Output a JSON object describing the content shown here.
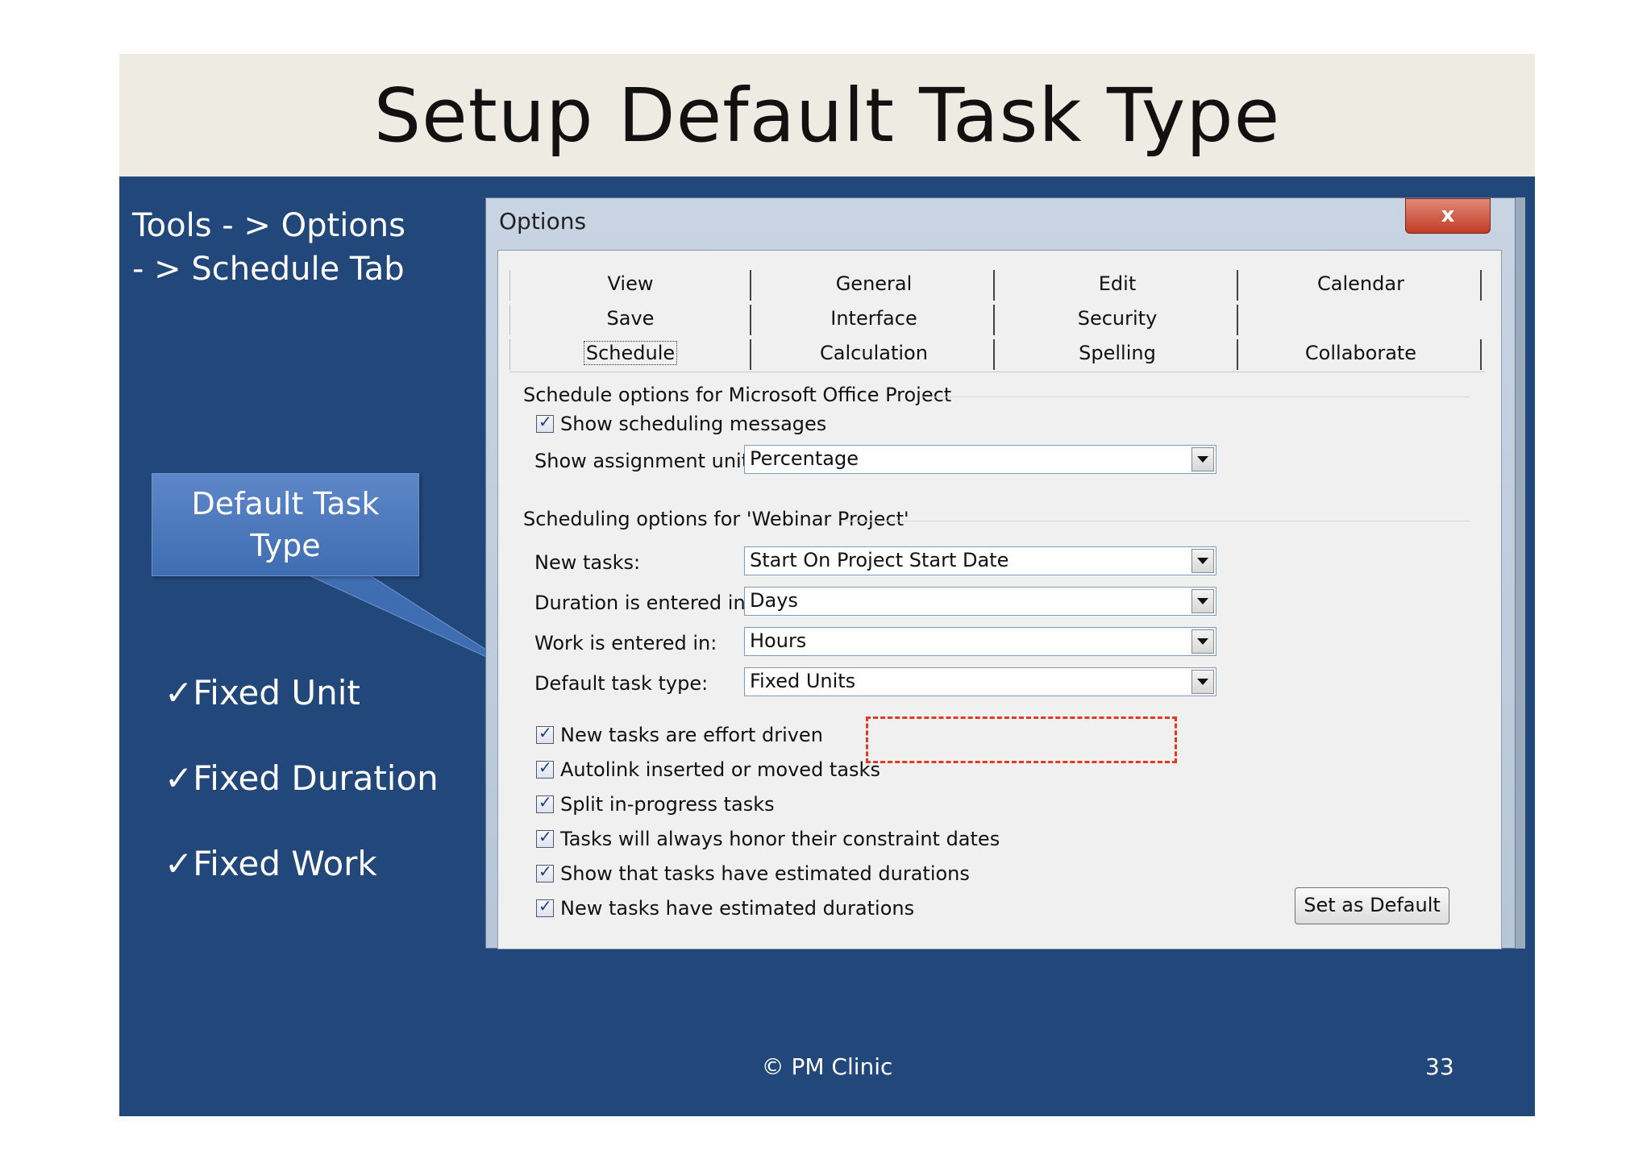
{
  "slide": {
    "title": "Setup Default Task Type",
    "nav_line1": "Tools - > Options",
    "nav_line2": "- > Schedule Tab",
    "callout_line1": "Default Task",
    "callout_line2": "Type",
    "checklist": [
      "✓Fixed Unit",
      "✓Fixed Duration",
      "✓Fixed Work"
    ],
    "footer_copyright": "© PM Clinic",
    "page_number": "33"
  },
  "dialog": {
    "title": "Options",
    "close_label": "x",
    "tabs": {
      "row1": [
        "View",
        "General",
        "Edit",
        "Calendar"
      ],
      "row2": [
        "Save",
        "Interface",
        "Security"
      ],
      "row3": [
        "Schedule",
        "Calculation",
        "Spelling",
        "Collaborate"
      ]
    },
    "schedule_group_label": "Schedule options for Microsoft Office Project",
    "show_scheduling_messages": "Show scheduling messages",
    "assignment_units_label": "Show assignment units as a:",
    "assignment_units_value": "Percentage",
    "project_group_label": "Scheduling options for 'Webinar Project'",
    "new_tasks_label": "New tasks:",
    "new_tasks_value": "Start On Project Start Date",
    "duration_label": "Duration is entered in:",
    "duration_value": "Days",
    "work_label": "Work is entered in:",
    "work_value": "Hours",
    "task_type_label": "Default task type:",
    "task_type_value": "Fixed Units",
    "checkboxes": [
      "New tasks are effort driven",
      "Autolink inserted or moved tasks",
      "Split in-progress tasks",
      "Tasks will always honor their constraint dates",
      "Show that tasks have estimated durations",
      "New tasks have estimated durations"
    ],
    "set_default_label": "Set as Default"
  },
  "colors": {
    "slide_background": "#22487b",
    "title_bar": "#eeebe2",
    "callout": "#4f7bbf",
    "highlight": "#e23a1e"
  }
}
